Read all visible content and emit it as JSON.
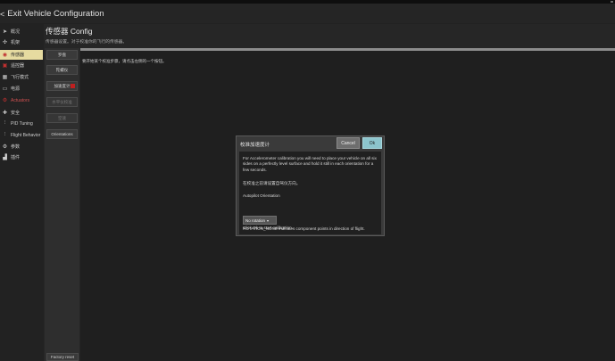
{
  "header": {
    "exit_label": "Exit Vehicle Configuration"
  },
  "sidebar": {
    "items": [
      {
        "label": "概况",
        "icon": "paper-plane-icon"
      },
      {
        "label": "机架",
        "icon": "airframe-icon"
      },
      {
        "label": "传感器",
        "icon": "sensors-icon",
        "active": true
      },
      {
        "label": "遥控器",
        "icon": "radio-icon"
      },
      {
        "label": "飞行模式",
        "icon": "flight-modes-icon"
      },
      {
        "label": "电源",
        "icon": "power-icon"
      },
      {
        "label": "Actuators",
        "icon": "actuators-icon"
      },
      {
        "label": "安全",
        "icon": "safety-icon"
      },
      {
        "label": "PID Tuning",
        "icon": "pid-icon"
      },
      {
        "label": "Flight Behavior",
        "icon": "flight-behavior-icon"
      },
      {
        "label": "参数",
        "icon": "params-icon"
      },
      {
        "label": "插件",
        "icon": "plugins-icon"
      }
    ]
  },
  "page": {
    "title": "传感器 Config",
    "subtitle": "传感器设置。对于校准你的飞行的传感器。",
    "instruction": "要开始某个校准步骤，请点击左侧的一个按钮。"
  },
  "sensor_buttons": [
    {
      "label": "罗盘",
      "enabled": true
    },
    {
      "label": "陀螺仪",
      "enabled": true
    },
    {
      "label": "加速度计",
      "enabled": true,
      "flag": true
    },
    {
      "label": "水平仪校准",
      "enabled": false
    },
    {
      "label": "空速",
      "enabled": false
    },
    {
      "label": "Orientations",
      "enabled": true
    }
  ],
  "factory_reset_label": "Factory reset",
  "dialog": {
    "title": "校准加速度计",
    "cancel_label": "Cancel",
    "ok_label": "Ok",
    "para1": "For Accelerometer calibration you will need to place your vehicle on all six sides on a perfectly level surface and hold it still in each orientation for a few seconds.",
    "para2": "在校准之前请设置自驾仪方向。",
    "orientation_label": "Autopilot Orientation",
    "orientation_value": "No rotation",
    "orientation_note": "ROTATION_NONE indicates component points in direction of flight.",
    "start_text": "Click Ok to start calibration."
  }
}
